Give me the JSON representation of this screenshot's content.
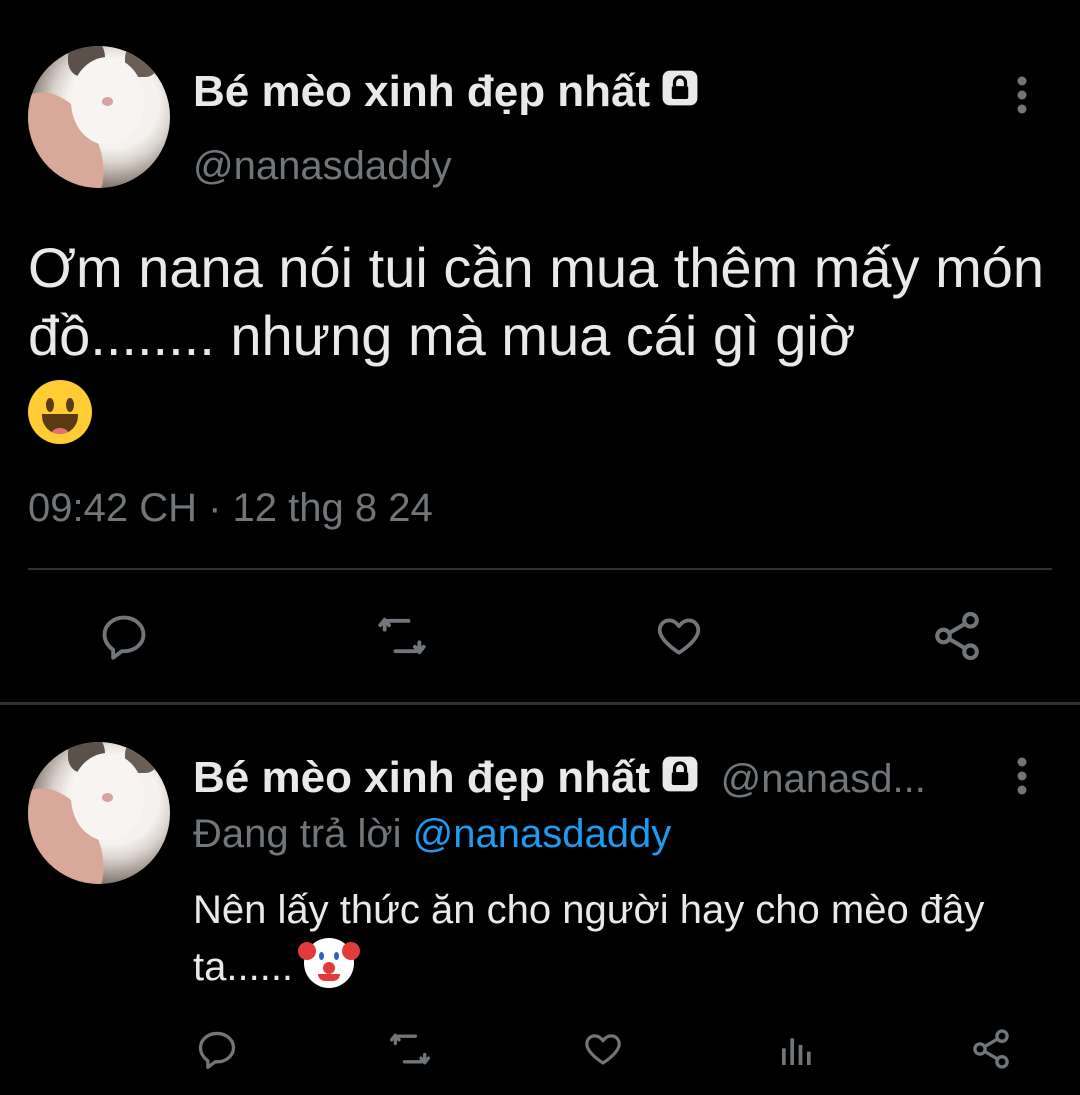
{
  "tweet": {
    "display_name": "Bé mèo xinh đẹp nhất",
    "handle": "@nanasdaddy",
    "text": "Ơm nana nói tui cần mua thêm mấy món đồ........ nhưng mà mua cái gì giờ",
    "emoji": "grinning-face-with-tongue",
    "timestamp": "09:42 CH · 12 thg 8 24",
    "more_icon": "more-vertical-icon",
    "actions": [
      "reply-icon",
      "retweet-icon",
      "like-icon",
      "share-icon"
    ]
  },
  "reply": {
    "display_name": "Bé mèo xinh đẹp nhất",
    "handle_truncated": "@nanasd...",
    "replying_prefix": "Đang trả lời",
    "replying_to": "@nanasdaddy",
    "text": "Nên lấy thức ăn cho người hay cho mèo đây ta......",
    "emoji": "clown-face",
    "more_icon": "more-vertical-icon",
    "actions": [
      "reply-icon",
      "retweet-icon",
      "like-icon",
      "views-icon",
      "share-icon"
    ]
  },
  "colors": {
    "background": "#000000",
    "text_primary": "#e7e9ea",
    "text_secondary": "#71767b",
    "link": "#1d9bf0",
    "divider": "#2f3336"
  }
}
